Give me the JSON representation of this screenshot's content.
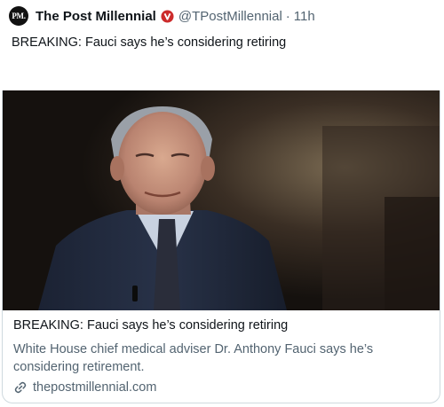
{
  "tweet": {
    "author_name": "The Post Millennial",
    "avatar_text": "PM.",
    "handle": "@TPostMillennial",
    "separator": "·",
    "time": "11h",
    "text": "BREAKING: Fauci says he’s considering retiring"
  },
  "card": {
    "title": "BREAKING: Fauci says he’s considering retiring",
    "description": "White House chief medical adviser Dr. Anthony Fauci says he’s considering retirement.",
    "domain": "thepostmillennial.com",
    "icon": "link-icon"
  },
  "colors": {
    "verified_badge": "#cc2b2b",
    "secondary_text": "#536471",
    "border": "#cfd9de"
  }
}
